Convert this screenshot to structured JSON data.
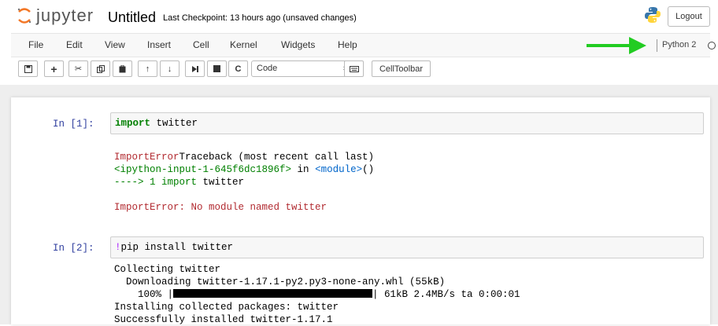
{
  "header": {
    "logo_text": "jupyter",
    "title": "Untitled",
    "checkpoint": "Last Checkpoint: 13 hours ago (unsaved changes)",
    "logout_label": "Logout"
  },
  "menu": [
    "File",
    "Edit",
    "View",
    "Insert",
    "Cell",
    "Kernel",
    "Widgets",
    "Help"
  ],
  "kernel": {
    "name": "Python 2"
  },
  "toolbar": {
    "cell_type": "Code",
    "celltoolbar_label": "CellToolbar"
  },
  "cells": [
    {
      "prompt": "In [1]:",
      "code_keyword": "import",
      "code_rest": " twitter",
      "output": {
        "l1_err": "ImportError",
        "l1_rest": "Traceback (most recent call last)",
        "l2_ipy": "<ipython-input-1-645f6dc1896f>",
        "l2_in": " in ",
        "l2_mod": "<module>",
        "l2_paren": "()",
        "l3_arrow": "----> 1 ",
        "l3_import": "import",
        "l3_rest": " twitter",
        "l5_err": "ImportError: No module named twitter"
      }
    },
    {
      "prompt": "In [2]:",
      "code_magic": "!",
      "code_rest": "pip install twitter",
      "output": {
        "l1": "Collecting twitter",
        "l2": "  Downloading twitter-1.17.1-py2.py3-none-any.whl (55kB)",
        "l3_pct": "    100% |",
        "l3_end": "| 61kB 2.4MB/s ta 0:00:01",
        "l4": "Installing collected packages: twitter",
        "l5": "Successfully installed twitter-1.17.1"
      },
      "progress_fraction": 1.0
    }
  ],
  "colors": {
    "prompt": "#303F9F",
    "error_red": "#B22B31",
    "keyword_green": "#008000",
    "module_blue": "#0065CA",
    "arrow_green": "#22CC22",
    "jupyter_orange": "#F37726"
  }
}
